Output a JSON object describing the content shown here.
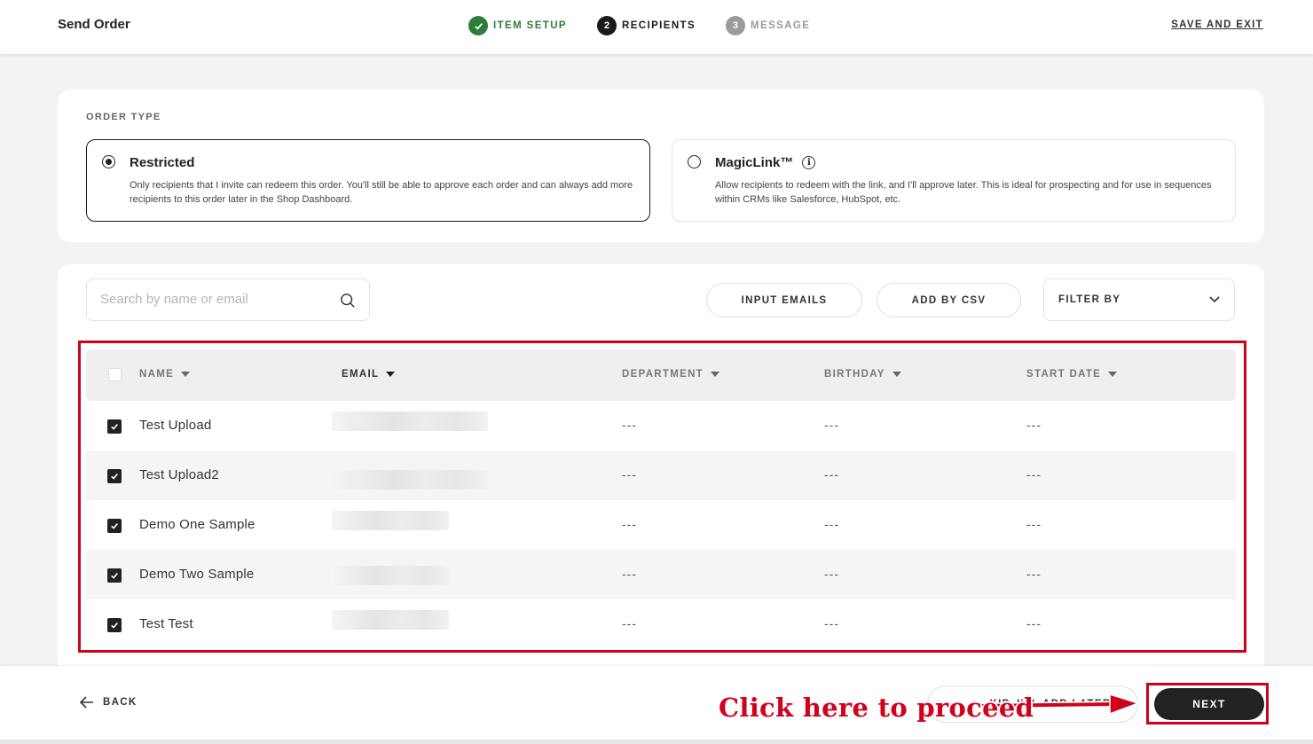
{
  "header": {
    "title": "Send Order",
    "steps": [
      {
        "num": "✓",
        "label": "ITEM SETUP"
      },
      {
        "num": "2",
        "label": "RECIPIENTS"
      },
      {
        "num": "3",
        "label": "MESSAGE"
      }
    ],
    "save_exit": "SAVE AND EXIT"
  },
  "order_type": {
    "label": "ORDER TYPE",
    "options": [
      {
        "title": "Restricted",
        "description": "Only recipients that I invite can redeem this order. You'll still be able to approve each order and can always add more recipients to this order later in the Shop Dashboard.",
        "selected": true
      },
      {
        "title": "MagicLink™",
        "description": "Allow recipients to redeem with the link, and I'll approve later. This is ideal for prospecting and for use in sequences within CRMs like Salesforce, HubSpot, etc.",
        "selected": false
      }
    ]
  },
  "recipients": {
    "search_placeholder": "Search by name or email",
    "input_emails": "INPUT EMAILS",
    "add_by_csv": "ADD BY CSV",
    "filter_by": "FILTER BY",
    "columns": [
      "NAME",
      "EMAIL",
      "DEPARTMENT",
      "BIRTHDAY",
      "START DATE"
    ],
    "rows": [
      {
        "name": "Test Upload",
        "department": "---",
        "birthday": "---",
        "start_date": "---",
        "checked": true
      },
      {
        "name": "Test Upload2",
        "department": "---",
        "birthday": "---",
        "start_date": "---",
        "checked": true
      },
      {
        "name": "Demo One Sample",
        "department": "---",
        "birthday": "---",
        "start_date": "---",
        "checked": true
      },
      {
        "name": "Demo Two Sample",
        "department": "---",
        "birthday": "---",
        "start_date": "---",
        "checked": true
      },
      {
        "name": "Test Test",
        "department": "---",
        "birthday": "---",
        "start_date": "---",
        "checked": true
      }
    ]
  },
  "footer": {
    "back": "BACK",
    "skip": "KIP, I'LL ADD LATER",
    "next": "NEXT",
    "callout": "Click here to proceed"
  },
  "colors": {
    "accent_done": "#2f7d3a",
    "annotation": "#d0021b",
    "primary_button": "#222222"
  }
}
